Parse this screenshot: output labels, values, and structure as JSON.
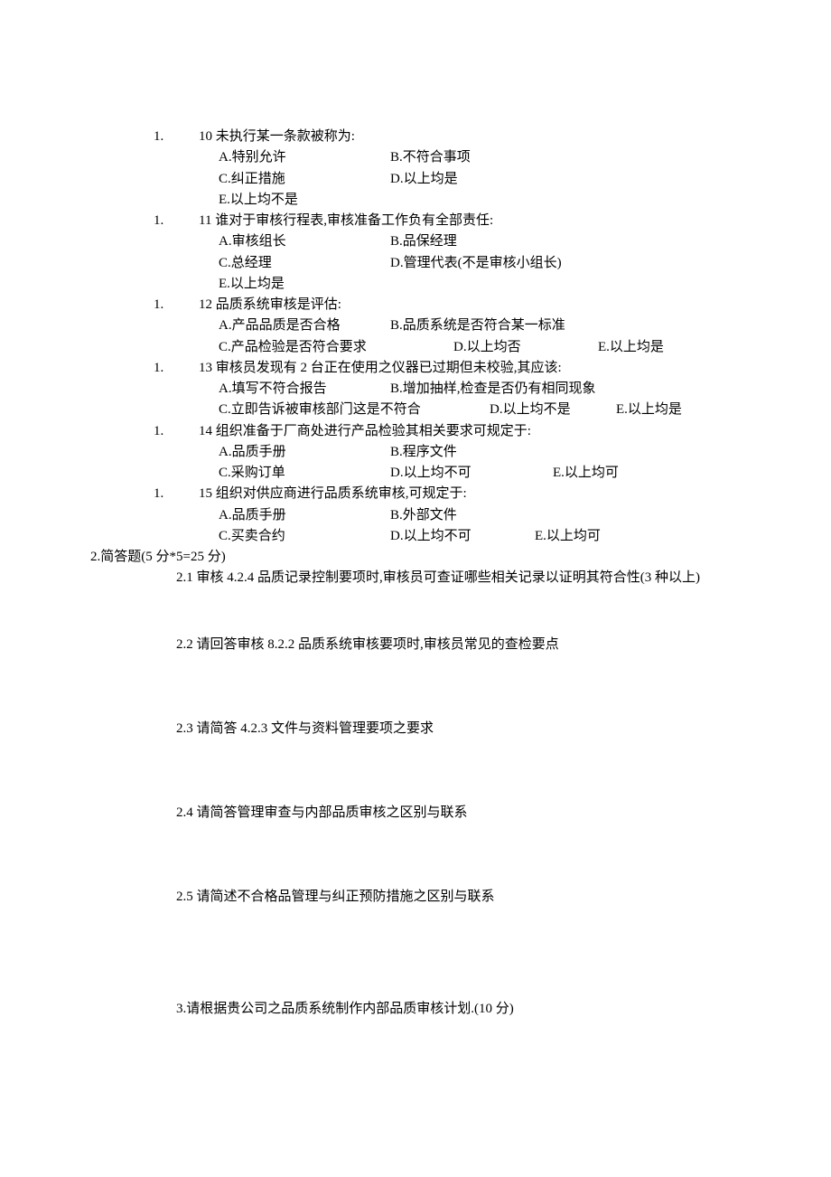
{
  "q10": {
    "marker": "1.",
    "stem": "10 未执行某一条款被称为:",
    "oA": "A.特别允许",
    "oB": "B.不符合事项",
    "oC": "C.纠正措施",
    "oD": "D.以上均是",
    "oE": "E.以上均不是"
  },
  "q11": {
    "marker": "1.",
    "stem": "11 谁对于审核行程表,审核准备工作负有全部责任:",
    "oA": "A.审核组长",
    "oB": "B.品保经理",
    "oC": "C.总经理",
    "oD": "D.管理代表(不是审核小组长)",
    "oE": "E.以上均是"
  },
  "q12": {
    "marker": "1.",
    "stem": "12 品质系统审核是评估:",
    "oA": "A.产品品质是否合格",
    "oB": "B.品质系统是否符合某一标准",
    "oC": "C.产品检验是否符合要求",
    "oD": "D.以上均否",
    "oE": "E.以上均是"
  },
  "q13": {
    "marker": "1.",
    "stem": "13 审核员发现有 2 台正在使用之仪器已过期但未校验,其应该:",
    "oA": "A.填写不符合报告",
    "oB": "B.增加抽样,检查是否仍有相同现象",
    "oC": "C.立即告诉被审核部门这是不符合",
    "oD": "D.以上均不是",
    "oE": "E.以上均是"
  },
  "q14": {
    "marker": "1.",
    "stem": "14 组织准备于厂商处进行产品检验其相关要求可规定于:",
    "oA": "A.品质手册",
    "oB": "B.程序文件",
    "oC": "C.采购订单",
    "oD": "D.以上均不可",
    "oE": "E.以上均可"
  },
  "q15": {
    "marker": "1.",
    "stem": "15 组织对供应商进行品质系统审核,可规定于:",
    "oA": "A.品质手册",
    "oB": "B.外部文件",
    "oC": "C.买卖合约",
    "oD": "D.以上均不可",
    "oE": "E.以上均可"
  },
  "sec2": {
    "head": "2.简答题(5 分*5=25 分)",
    "s1": "2.1 审核 4.2.4 品质记录控制要项时,审核员可查证哪些相关记录以证明其符合性(3 种以上)",
    "s2": "2.2 请回答审核 8.2.2 品质系统审核要项时,审核员常见的查检要点",
    "s3": "2.3 请简答 4.2.3 文件与资料管理要项之要求",
    "s4": "2.4 请简答管理审查与内部品质审核之区别与联系",
    "s5": "2.5 请简述不合格品管理与纠正预防措施之区别与联系"
  },
  "sec3": {
    "text": "3.请根据贵公司之品质系统制作内部品质审核计划.(10 分)"
  }
}
